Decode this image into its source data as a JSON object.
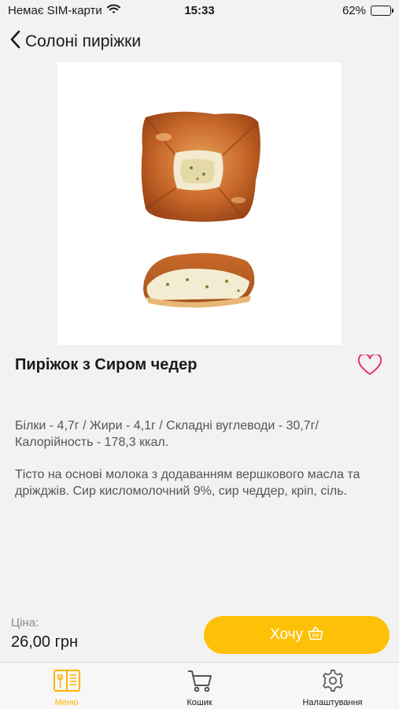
{
  "status_bar": {
    "carrier": "Немає SIM-карти",
    "time": "15:33",
    "battery_percent": "62%",
    "battery_level": 0.62
  },
  "nav": {
    "back_label": "Солоні пиріжки"
  },
  "product": {
    "title": "Пиріжок з Сиром чедер",
    "nutrition": "Білки - 4,7г / Жири - 4,1г / Складні вуглеводи - 30,7г/ Калорійность - 178,3 ккал.",
    "description": "Тісто на основі молока з додаванням вершкового масла та дріжджів. Сир кисломолочний 9%, сир чеддер, кріп, сіль."
  },
  "purchase": {
    "price_label": "Ціна:",
    "price_value": "26,00 грн",
    "want_label": "Хочу"
  },
  "tabs": [
    {
      "label": "Меню",
      "icon": "menu-book-icon",
      "active": true
    },
    {
      "label": "Кошик",
      "icon": "cart-icon",
      "active": false
    },
    {
      "label": "Налаштування",
      "icon": "gear-icon",
      "active": false
    }
  ],
  "colors": {
    "accent": "#ffc107",
    "active_tab": "#ffb300",
    "favorite": "#e8306c"
  }
}
